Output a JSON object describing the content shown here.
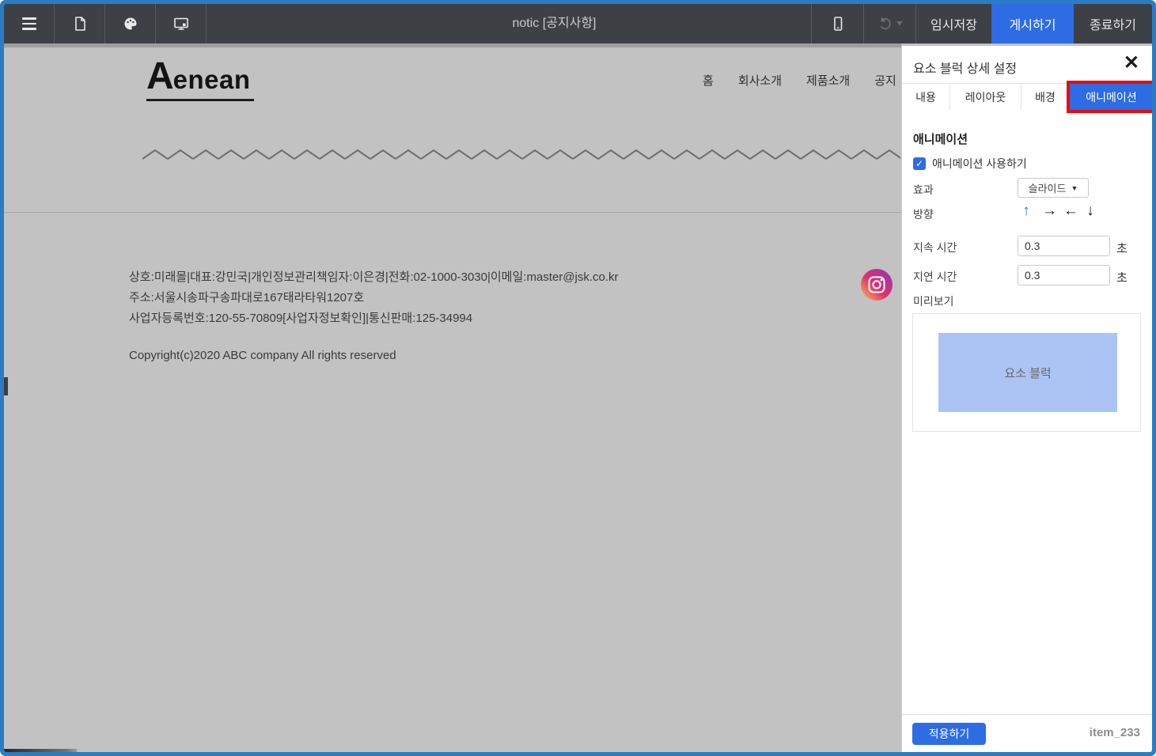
{
  "toolbar": {
    "title": "notic [공지사항]",
    "buttons": {
      "temp_save": "임시저장",
      "publish": "게시하기",
      "exit": "종료하기"
    }
  },
  "site": {
    "logo_initial": "A",
    "logo_rest": "enean",
    "nav": [
      "홈",
      "회사소개",
      "제품소개",
      "공지"
    ],
    "footer_lines": [
      "상호:미래몰|대표:강민국|개인정보관리책임자:이은경|전화:02-1000-3030|이메일:master@jsk.co.kr",
      "주소:서울시송파구송파대로167태라타워1207호",
      "사업자등록번호:120-55-70809[사업자정보확인]|통신판매:125-34994"
    ],
    "copyright": "Copyright(c)2020 ABC company All rights reserved"
  },
  "panel": {
    "title": "요소 블럭 상세 설정",
    "tabs": [
      {
        "label": "내용",
        "active": false
      },
      {
        "label": "레이아웃",
        "active": false
      },
      {
        "label": "배경",
        "active": false
      },
      {
        "label": "애니메이션",
        "active": true
      }
    ],
    "animation": {
      "section_title": "애니메이션",
      "use_label": "애니메이션 사용하기",
      "use_checked": true,
      "effect_label": "효과",
      "effect_value": "슬라이드",
      "direction_label": "방향",
      "selected_direction": "up",
      "duration_label": "지속 시간",
      "duration_value": "0.3",
      "delay_label": "지연 시간",
      "delay_value": "0.3",
      "time_unit": "초",
      "preview_label": "미리보기",
      "preview_block_label": "요소 블럭"
    },
    "footer": {
      "apply_label": "적용하기",
      "item_id": "item_233"
    }
  },
  "icons": {
    "close": "✕",
    "caret_down": "▼",
    "arrow_up": "↑",
    "arrow_right": "→",
    "arrow_left": "←",
    "arrow_down": "↓",
    "check": "✓"
  },
  "colors": {
    "accent_blue": "#2e6ce4",
    "highlight_red": "#e80b0b",
    "toolbar_bg": "#3d4145",
    "canvas_bg": "#c2c2c2",
    "preview_block": "#abc4f3",
    "frame_border": "#2b7cc4"
  }
}
